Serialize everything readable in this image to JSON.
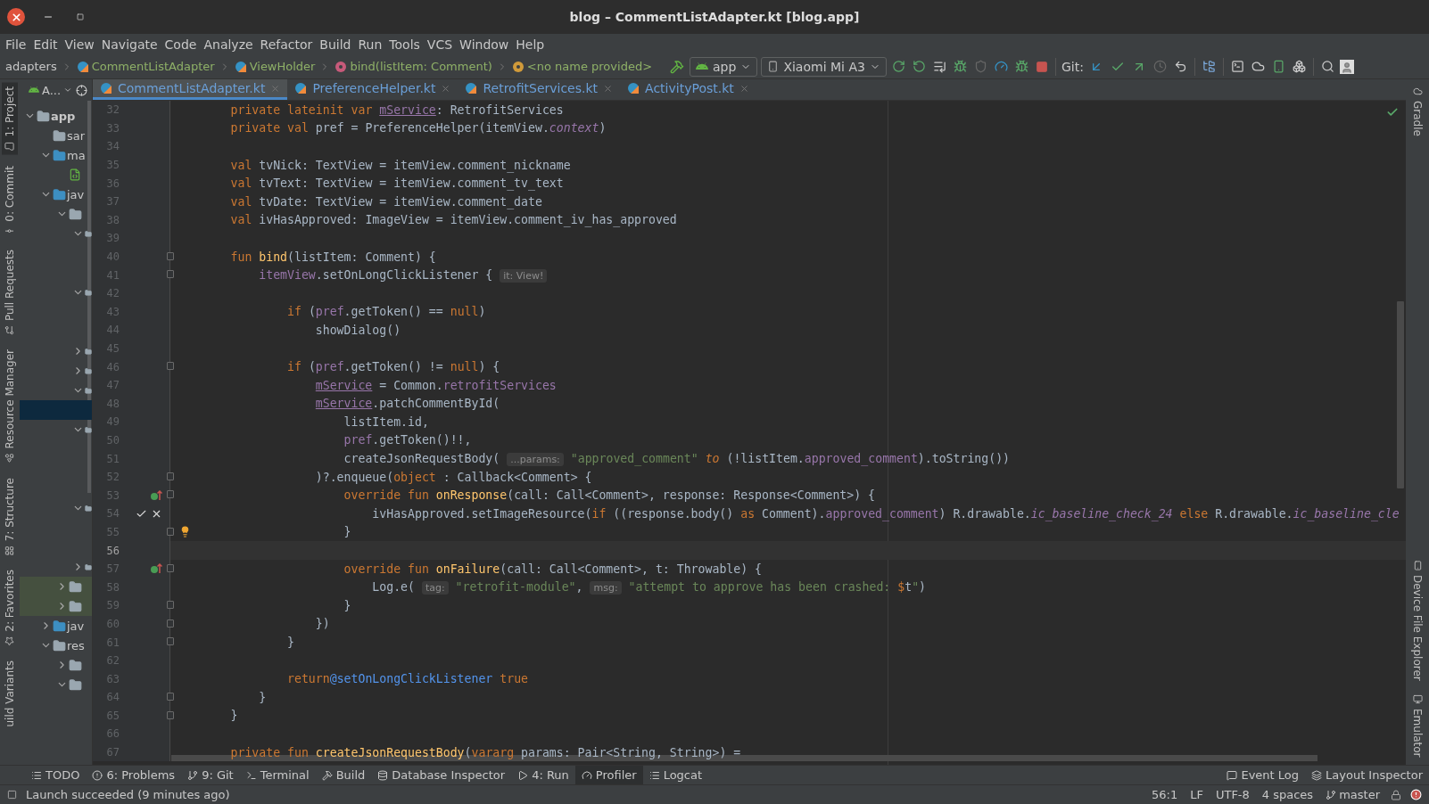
{
  "window": {
    "title": "blog – CommentListAdapter.kt [blog.app]"
  },
  "menu": [
    "File",
    "Edit",
    "View",
    "Navigate",
    "Code",
    "Analyze",
    "Refactor",
    "Build",
    "Run",
    "Tools",
    "VCS",
    "Window",
    "Help"
  ],
  "breadcrumbs": [
    {
      "kind": "package",
      "label": "adapters"
    },
    {
      "kind": "class",
      "label": "CommentListAdapter"
    },
    {
      "kind": "class",
      "label": "ViewHolder"
    },
    {
      "kind": "method",
      "label": "bind(listItem: Comment)"
    },
    {
      "kind": "object",
      "label": "<no name provided>"
    }
  ],
  "run_config": "app",
  "device": "Xiaomi Mi A3",
  "git_label": "Git:",
  "left_stripe": [
    {
      "label": "1: Project",
      "selected": true
    },
    {
      "label": "0: Commit",
      "selected": false
    },
    {
      "label": "Pull Requests",
      "selected": false
    },
    {
      "label": "Resource Manager",
      "selected": false
    },
    {
      "label": "7: Structure",
      "selected": false
    },
    {
      "label": "2: Favorites",
      "selected": false
    },
    {
      "label": "uild Variants",
      "selected": false
    }
  ],
  "right_stripe": [
    {
      "label": "Gradle"
    },
    {
      "label": "Device File Explorer"
    },
    {
      "label": "Emulator"
    }
  ],
  "project": {
    "view_selector": "A...",
    "tree": [
      {
        "kind": "module",
        "label": "app",
        "expanded": true,
        "selected": false,
        "children": [
          {
            "kind": "folder",
            "label": "sar",
            "selected": false
          },
          {
            "kind": "source",
            "label": "ma",
            "expanded": true,
            "selected": false,
            "children": [
              {
                "kind": "manifest",
                "selected": false
              }
            ]
          },
          {
            "kind": "source",
            "label": "jav",
            "expanded": true,
            "selected": false,
            "children": [
              {
                "kind": "package",
                "expanded": true,
                "selected": false,
                "children": [
                  {
                    "kind": "package",
                    "expanded": true,
                    "selected": false,
                    "children": [
                      {
                        "selected": false
                      },
                      {
                        "selected": false
                      }
                    ]
                  },
                  {
                    "kind": "package",
                    "expanded": true,
                    "selected": false,
                    "children": [
                      {
                        "selected": false
                      },
                      {
                        "selected": false
                      }
                    ]
                  },
                  {
                    "kind": "package",
                    "expanded": false,
                    "selected": false
                  },
                  {
                    "kind": "package",
                    "expanded": false,
                    "selected": false
                  },
                  {
                    "kind": "package",
                    "expanded": true,
                    "selected": false,
                    "children": [
                      {
                        "selected": true
                      }
                    ]
                  },
                  {
                    "kind": "package",
                    "expanded": true,
                    "selected": false,
                    "children": [
                      {
                        "selected": false
                      },
                      {
                        "selected": false
                      },
                      {
                        "selected": false
                      }
                    ]
                  },
                  {
                    "kind": "package",
                    "expanded": true,
                    "selected": false,
                    "children": [
                      {
                        "selected": false
                      },
                      {
                        "selected": false
                      }
                    ]
                  },
                  {
                    "kind": "package",
                    "expanded": false,
                    "selected": false
                  }
                ]
              },
              {
                "kind": "test",
                "expanded": false,
                "selected": false
              },
              {
                "kind": "test",
                "expanded": false,
                "selected": false
              }
            ]
          },
          {
            "kind": "generated",
            "label": "jav",
            "expanded": false,
            "selected": false
          },
          {
            "kind": "resources",
            "label": "res",
            "expanded": true,
            "selected": false,
            "children": [
              {
                "kind": "package",
                "expanded": false,
                "selected": false
              },
              {
                "kind": "package",
                "expanded": true,
                "selected": false
              }
            ]
          }
        ]
      }
    ]
  },
  "editor_tabs": [
    {
      "label": "CommentListAdapter.kt",
      "selected": true
    },
    {
      "label": "PreferenceHelper.kt",
      "selected": false
    },
    {
      "label": "RetrofitServices.kt",
      "selected": false
    },
    {
      "label": "ActivityPost.kt",
      "selected": false
    }
  ],
  "code": [
    {
      "number": "32",
      "fold": false,
      "current": false,
      "tokens": [
        {
          "kind": "kw",
          "text": "        private lateinit var "
        },
        {
          "kind": "u",
          "text": "mService"
        },
        {
          "kind": "t",
          "text": ": RetrofitServices"
        }
      ]
    },
    {
      "number": "33",
      "fold": false,
      "current": false,
      "tokens": [
        {
          "kind": "kw",
          "text": "        private val "
        },
        {
          "kind": "t",
          "text": "pref = PreferenceHelper(itemView."
        },
        {
          "kind": "pi",
          "text": "context"
        },
        {
          "kind": "t",
          "text": ")"
        }
      ]
    },
    {
      "number": "34",
      "fold": false,
      "current": false
    },
    {
      "number": "35",
      "fold": false,
      "current": false,
      "tokens": [
        {
          "kind": "kw",
          "text": "        val "
        },
        {
          "kind": "t",
          "text": "tvNick: TextView = itemView.comment_nickname"
        }
      ]
    },
    {
      "number": "36",
      "fold": false,
      "current": false,
      "tokens": [
        {
          "kind": "kw",
          "text": "        val "
        },
        {
          "kind": "t",
          "text": "tvText: TextView = itemView.comment_tv_text"
        }
      ]
    },
    {
      "number": "37",
      "fold": false,
      "current": false,
      "tokens": [
        {
          "kind": "kw",
          "text": "        val "
        },
        {
          "kind": "t",
          "text": "tvDate: TextView = itemView.comment_date"
        }
      ]
    },
    {
      "number": "38",
      "fold": false,
      "current": false,
      "tokens": [
        {
          "kind": "kw",
          "text": "        val "
        },
        {
          "kind": "t",
          "text": "ivHasApproved: ImageView = itemView.comment_iv_has_approved"
        }
      ]
    },
    {
      "number": "39",
      "fold": false,
      "current": false
    },
    {
      "number": "40",
      "fold": true,
      "current": false,
      "tokens": [
        {
          "kind": "kw",
          "text": "        fun "
        },
        {
          "kind": "f",
          "text": "bind"
        },
        {
          "kind": "t",
          "text": "(listItem: Comment) {"
        }
      ]
    },
    {
      "number": "41",
      "fold": true,
      "current": false,
      "tokens": [
        {
          "kind": "p",
          "text": "            itemView"
        },
        {
          "kind": "t",
          "text": ".setOnLongClickListener { "
        },
        {
          "kind": "h",
          "text": "it: View!"
        }
      ]
    },
    {
      "number": "42",
      "fold": false,
      "current": false
    },
    {
      "number": "43",
      "fold": false,
      "current": false,
      "tokens": [
        {
          "kind": "kw",
          "text": "                if "
        },
        {
          "kind": "t",
          "text": "("
        },
        {
          "kind": "p",
          "text": "pref"
        },
        {
          "kind": "t",
          "text": ".getToken() == "
        },
        {
          "kind": "kw",
          "text": "null"
        },
        {
          "kind": "t",
          "text": ")"
        }
      ]
    },
    {
      "number": "44",
      "fold": false,
      "current": false,
      "tokens": [
        {
          "kind": "t",
          "text": "                    showDialog()"
        }
      ]
    },
    {
      "number": "45",
      "fold": false,
      "current": false
    },
    {
      "number": "46",
      "fold": true,
      "current": false,
      "tokens": [
        {
          "kind": "kw",
          "text": "                if "
        },
        {
          "kind": "t",
          "text": "("
        },
        {
          "kind": "p",
          "text": "pref"
        },
        {
          "kind": "t",
          "text": ".getToken() != "
        },
        {
          "kind": "kw",
          "text": "null"
        },
        {
          "kind": "t",
          "text": ") {"
        }
      ]
    },
    {
      "number": "47",
      "fold": false,
      "current": false,
      "tokens": [
        {
          "kind": "u",
          "text": "                    mService"
        },
        {
          "kind": "t",
          "text": " = Common."
        },
        {
          "kind": "p",
          "text": "retrofitServices"
        }
      ]
    },
    {
      "number": "48",
      "fold": false,
      "current": false,
      "tokens": [
        {
          "kind": "u",
          "text": "                    mService"
        },
        {
          "kind": "t",
          "text": ".patchCommentById("
        }
      ]
    },
    {
      "number": "49",
      "fold": false,
      "current": false,
      "tokens": [
        {
          "kind": "t",
          "text": "                        listItem.id,"
        }
      ]
    },
    {
      "number": "50",
      "fold": false,
      "current": false,
      "tokens": [
        {
          "kind": "p",
          "text": "                        pref"
        },
        {
          "kind": "t",
          "text": ".getToken()!!,"
        }
      ]
    },
    {
      "number": "51",
      "fold": false,
      "current": false,
      "tokens": [
        {
          "kind": "t",
          "text": "                        createJsonRequestBody( "
        },
        {
          "kind": "h",
          "text": "...params:"
        },
        {
          "kind": "s",
          "text": " \"approved_comment\""
        },
        {
          "kind": "i",
          "text": " to "
        },
        {
          "kind": "t",
          "text": "(!listItem."
        },
        {
          "kind": "p",
          "text": "approved_comment"
        },
        {
          "kind": "t",
          "text": ").toString())"
        }
      ]
    },
    {
      "number": "52",
      "fold": true,
      "current": false,
      "tokens": [
        {
          "kind": "t",
          "text": "                    )?.enqueue("
        },
        {
          "kind": "kw",
          "text": "object"
        },
        {
          "kind": "t",
          "text": " : Callback<Comment> {"
        }
      ]
    },
    {
      "number": "53",
      "fold": true,
      "current": false,
      "kind": "override",
      "tokens": [
        {
          "kind": "kw",
          "text": "                        override fun "
        },
        {
          "kind": "f",
          "text": "onResponse"
        },
        {
          "kind": "t",
          "text": "(call: Call<Comment>, response: Response<Comment>) {"
        }
      ]
    },
    {
      "number": "54",
      "fold": false,
      "current": false,
      "kind": "check-cross",
      "tokens": [
        {
          "kind": "t",
          "text": "                            ivHasApproved.setImageResource("
        },
        {
          "kind": "kw",
          "text": "if "
        },
        {
          "kind": "t",
          "text": "((response.body() "
        },
        {
          "kind": "kw",
          "text": "as "
        },
        {
          "kind": "t",
          "text": "Comment)."
        },
        {
          "kind": "p",
          "text": "approved_comment"
        },
        {
          "kind": "t",
          "text": ") R.drawable."
        },
        {
          "kind": "pi",
          "text": "ic_baseline_check_24"
        },
        {
          "kind": "kw",
          "text": " else "
        },
        {
          "kind": "t",
          "text": "R.drawable."
        },
        {
          "kind": "pi",
          "text": "ic_baseline_cle"
        }
      ]
    },
    {
      "number": "55",
      "fold": true,
      "current": false,
      "kind": "bulb",
      "tokens": [
        {
          "kind": "t",
          "text": "                        }"
        }
      ]
    },
    {
      "number": "56",
      "fold": false,
      "current": true
    },
    {
      "number": "57",
      "fold": true,
      "current": false,
      "kind": "override",
      "tokens": [
        {
          "kind": "kw",
          "text": "                        override fun "
        },
        {
          "kind": "f",
          "text": "onFailure"
        },
        {
          "kind": "t",
          "text": "(call: Call<Comment>, t: Throwable) {"
        }
      ]
    },
    {
      "number": "58",
      "fold": false,
      "current": false,
      "tokens": [
        {
          "kind": "t",
          "text": "                            Log.e( "
        },
        {
          "kind": "h",
          "text": "tag:"
        },
        {
          "kind": "s",
          "text": " \"retrofit-module\""
        },
        {
          "kind": "t",
          "text": ", "
        },
        {
          "kind": "h",
          "text": "msg:"
        },
        {
          "kind": "s",
          "text": " \"attempt to approve has been crashed: "
        },
        {
          "kind": "kw",
          "text": "$"
        },
        {
          "kind": "t",
          "text": "t"
        },
        {
          "kind": "s",
          "text": "\""
        },
        {
          "kind": "t",
          "text": ")"
        }
      ]
    },
    {
      "number": "59",
      "fold": true,
      "current": false,
      "tokens": [
        {
          "kind": "t",
          "text": "                        }"
        }
      ]
    },
    {
      "number": "60",
      "fold": true,
      "current": false,
      "tokens": [
        {
          "kind": "t",
          "text": "                    })"
        }
      ]
    },
    {
      "number": "61",
      "fold": true,
      "current": false,
      "tokens": [
        {
          "kind": "t",
          "text": "                }"
        }
      ]
    },
    {
      "number": "62",
      "fold": false,
      "current": false
    },
    {
      "number": "63",
      "fold": false,
      "current": false,
      "tokens": [
        {
          "kind": "kw",
          "text": "                return"
        },
        {
          "kind": "l",
          "text": "@setOnLongClickListener"
        },
        {
          "kind": "kw",
          "text": " true"
        }
      ]
    },
    {
      "number": "64",
      "fold": true,
      "current": false,
      "tokens": [
        {
          "kind": "t",
          "text": "            }"
        }
      ]
    },
    {
      "number": "65",
      "fold": true,
      "current": false,
      "tokens": [
        {
          "kind": "t",
          "text": "        }"
        }
      ]
    },
    {
      "number": "66",
      "fold": false,
      "current": false
    },
    {
      "number": "67",
      "fold": false,
      "current": false,
      "tokens": [
        {
          "kind": "kw",
          "text": "        private fun "
        },
        {
          "kind": "f",
          "text": "createJsonRequestBody"
        },
        {
          "kind": "t",
          "text": "("
        },
        {
          "kind": "kw",
          "text": "vararg "
        },
        {
          "kind": "t",
          "text": "params: Pair<String, String>) ="
        }
      ]
    }
  ],
  "tool_tabs": [
    {
      "label": "TODO",
      "selected": false
    },
    {
      "label": "6: Problems",
      "selected": false
    },
    {
      "label": "9: Git",
      "selected": false
    },
    {
      "label": "Terminal",
      "selected": false
    },
    {
      "label": "Build",
      "selected": false
    },
    {
      "label": "Database Inspector",
      "selected": false
    },
    {
      "label": "4: Run",
      "selected": false
    },
    {
      "label": "Profiler",
      "selected": true
    },
    {
      "label": "Logcat",
      "selected": false
    }
  ],
  "tool_tabs_right": [
    {
      "label": "Event Log"
    },
    {
      "label": "Layout Inspector"
    }
  ],
  "status_bar": {
    "message": "Launch succeeded (9 minutes ago)",
    "position": "56:1",
    "line_separator": "LF",
    "encoding": "UTF-8",
    "indent": "4 spaces",
    "branch": "master"
  }
}
